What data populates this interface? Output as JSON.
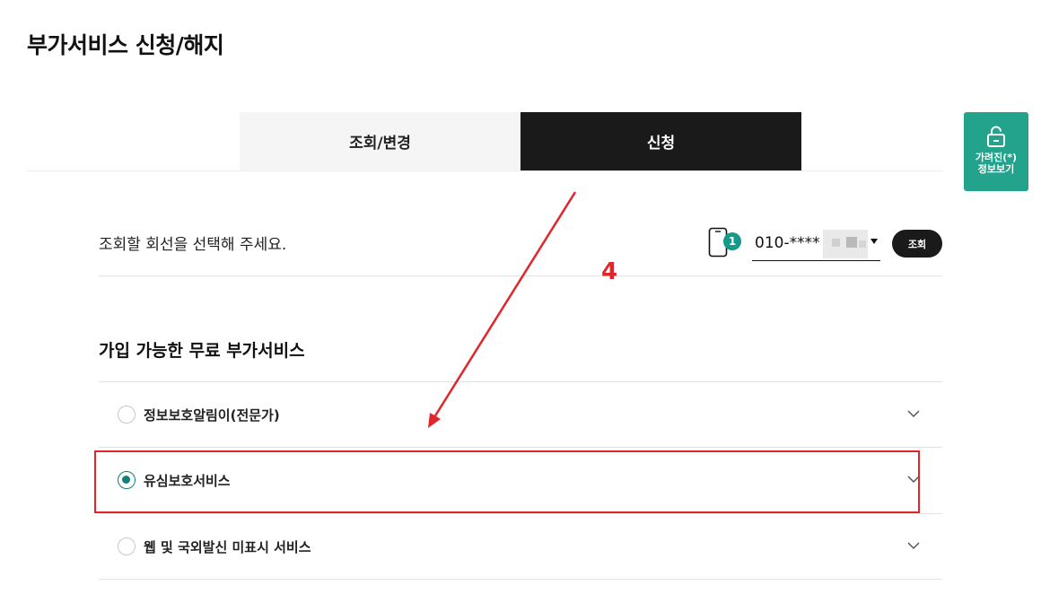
{
  "page": {
    "title": "부가서비스 신청/해지"
  },
  "tabs": [
    {
      "label": "조회/변경",
      "active": false
    },
    {
      "label": "신청",
      "active": true
    }
  ],
  "side_button": {
    "label": "가려진(*)\n정보보기",
    "icon": "unlock-icon",
    "color": "#23a38b"
  },
  "line_select": {
    "prompt": "조회할 회선을 선택해 주세요.",
    "icon": "phone-icon",
    "badge": "1",
    "number": "010-****",
    "query_label": "조회"
  },
  "section": {
    "title": "가입 가능한 무료 부가서비스",
    "items": [
      {
        "label": "정보보호알림이(전문가)",
        "selected": false
      },
      {
        "label": "유심보호서비스",
        "selected": true
      },
      {
        "label": "웹 및 국외발신 미표시 서비스",
        "selected": false
      }
    ]
  },
  "annotation": {
    "step": "4",
    "color": "#e0262a"
  },
  "colors": {
    "accent": "#14807a",
    "tab_active_bg": "#1a1a1a",
    "tab_inactive_bg": "#f5f5f5"
  }
}
